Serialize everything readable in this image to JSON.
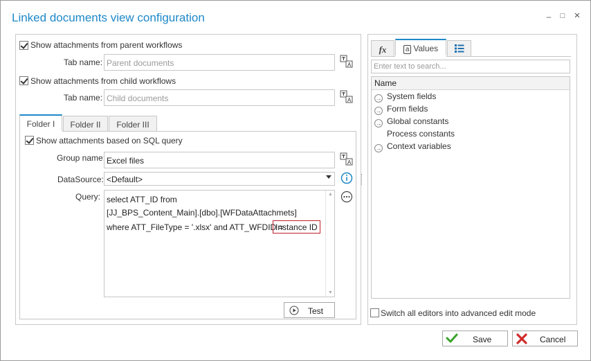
{
  "window": {
    "title": "Linked documents view configuration",
    "min_glyph": "–",
    "max_glyph": "□",
    "close_glyph": "×"
  },
  "parent": {
    "checkbox_label": "Show attachments from parent workflows",
    "checked": true,
    "tab_name_label": "Tab name:",
    "tab_name_placeholder": "Parent documents"
  },
  "child": {
    "checkbox_label": "Show attachments from child workflows",
    "checked": true,
    "tab_name_label": "Tab name:",
    "tab_name_placeholder": "Child documents"
  },
  "folder_tabs": [
    {
      "label": "Folder I",
      "active": true
    },
    {
      "label": "Folder II",
      "active": false
    },
    {
      "label": "Folder III",
      "active": false
    }
  ],
  "folder": {
    "sql_checkbox_label": "Show attachments based on SQL query",
    "sql_checked": true,
    "group_name_label": "Group name:",
    "group_name_value": "Excel files",
    "datasource_label": "DataSource:",
    "datasource_value": "<Default>",
    "query_label": "Query:",
    "query_lines": [
      "select ATT_ID from",
      "[JJ_BPS_Content_Main].[dbo].[WFDataAttachmets]",
      "where ATT_FileType = '.xlsx' and ATT_WFDID = "
    ],
    "query_token": "Instance ID",
    "test_label": "Test"
  },
  "right_tabs": [
    {
      "label": "",
      "icon": "fx-icon",
      "glyph": "fx",
      "active": false
    },
    {
      "label": "Values",
      "icon": "values-icon",
      "glyph": "a",
      "active": true
    },
    {
      "label": "",
      "icon": "list-icon",
      "active": false
    }
  ],
  "search": {
    "placeholder": "Enter text to search..."
  },
  "tree": {
    "header": "Name",
    "items": [
      {
        "label": "System fields",
        "expandable": true
      },
      {
        "label": "Form fields",
        "expandable": true
      },
      {
        "label": "Global constants",
        "expandable": true
      },
      {
        "label": "Process constants",
        "expandable": false
      },
      {
        "label": "Context variables",
        "expandable": true
      }
    ]
  },
  "advanced_mode": {
    "label": "Switch all editors into advanced edit mode",
    "checked": false
  },
  "footer": {
    "save_label": "Save",
    "cancel_label": "Cancel"
  },
  "colors": {
    "accent": "#1e88c8",
    "save_icon": "#3aa12a",
    "cancel_icon": "#d02a2a",
    "token_border": "#c0202a",
    "info_icon": "#1e88c8"
  }
}
